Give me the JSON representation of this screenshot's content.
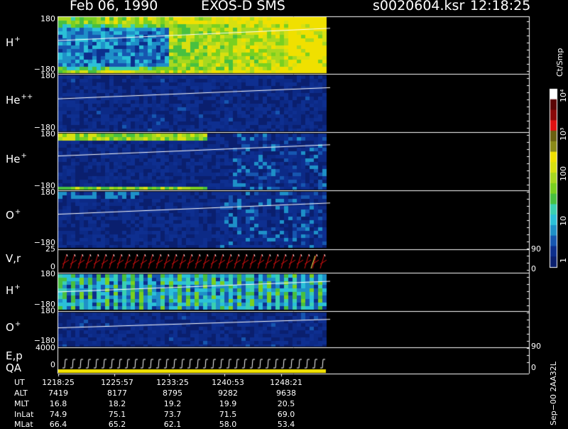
{
  "header": {
    "date": "Feb 06, 1990",
    "instrument": "EXOS-D SMS",
    "file": "s0020604.ksr",
    "time": "12:18:25"
  },
  "panels": [
    {
      "species": "H",
      "charge": "+",
      "ytop": "180",
      "ybottom": "−180"
    },
    {
      "species": "He",
      "charge": "++",
      "ytop": "180",
      "ybottom": "−180"
    },
    {
      "species": "He",
      "charge": "+",
      "ytop": "180",
      "ybottom": "−180"
    },
    {
      "species": "O",
      "charge": "+",
      "ytop": "180",
      "ybottom": "−180"
    },
    {
      "species": "V,r",
      "charge": "",
      "ytop": "25",
      "ybottom": "0",
      "rtop": "90",
      "rbottom": "0"
    },
    {
      "species": "H",
      "charge": "+",
      "ytop": "180",
      "ybottom": "−180"
    },
    {
      "species": "O",
      "charge": "+",
      "ytop": "180",
      "ybottom": "−180"
    },
    {
      "species": "E,p",
      "charge": "",
      "ytop": "4000",
      "ybottom": "0",
      "rtop": "90",
      "rbottom": "0"
    }
  ],
  "qa_label": "QA",
  "colorbar": {
    "title": "Ct/Smp",
    "ticks": [
      "1",
      "10",
      "100",
      "10³",
      "10⁴"
    ],
    "colors": [
      "#0a1f6e",
      "#0c2e8c",
      "#1656b0",
      "#1e90c8",
      "#2bc0d8",
      "#3ad0b0",
      "#48c040",
      "#7ad020",
      "#a8d820",
      "#d8e010",
      "#f0e000",
      "#8a8a18",
      "#6a6010",
      "#e01010",
      "#8a0808",
      "#5a0404",
      "#ffffff"
    ]
  },
  "orbit": {
    "labels": [
      "UT",
      "ALT",
      "MLT",
      "InLat",
      "MLat"
    ],
    "columns": [
      [
        "1218:25",
        "7419",
        "16.8",
        "74.9",
        "66.4"
      ],
      [
        "1225:57",
        "8177",
        "18.2",
        "75.1",
        "65.2"
      ],
      [
        "1233:25",
        "8795",
        "19.2",
        "73.7",
        "62.1"
      ],
      [
        "1240:53",
        "9282",
        "19.9",
        "71.5",
        "58.0"
      ],
      [
        "1248:21",
        "9638",
        "20.5",
        "69.0",
        "53.4"
      ]
    ]
  },
  "footer_stamp": "Sep−00  2AA32L",
  "chart_data": {
    "type": "heatmap",
    "title": "Feb 06, 1990   EXOS-D SMS",
    "x_ticks": [
      "1218:25",
      "1225:57",
      "1233:25",
      "1240:53",
      "1248:21"
    ],
    "y_range_pitch_deg": [
      -180,
      180
    ],
    "panels": [
      "H+",
      "He++",
      "He+",
      "O+",
      "V,r",
      "H+",
      "O+",
      "E,p"
    ],
    "colorbar_label": "Ct/Smp",
    "colorbar_range": [
      "1",
      "10⁴"
    ],
    "log_scale": true
  }
}
